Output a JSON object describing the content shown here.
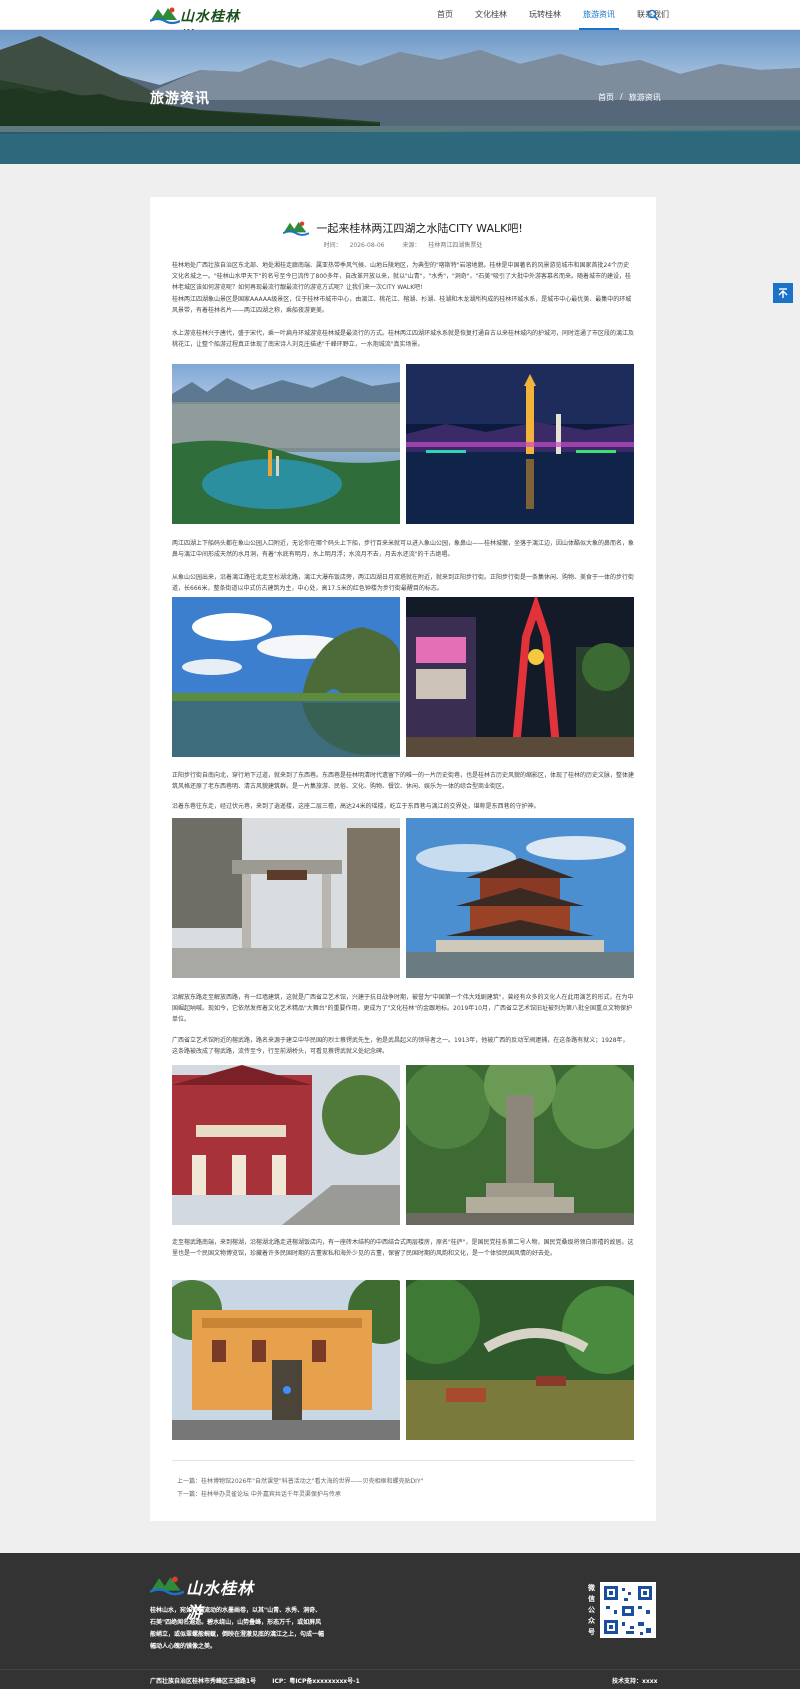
{
  "header": {
    "logo_text": "山水桂林游",
    "nav": [
      "首页",
      "文化桂林",
      "玩转桂林",
      "旅游资讯",
      "联系我们"
    ],
    "active_nav": "旅游资讯"
  },
  "banner": {
    "title": "旅游资讯",
    "breadcrumb": [
      "首页",
      "/",
      "旅游资讯"
    ]
  },
  "article": {
    "title": "一起来桂林两江四湖之水陆CITY WALK吧!",
    "time_label": "时间：",
    "time": "2026-08-06",
    "source_label": "来源：",
    "source": "桂林两江四湖售票处",
    "paragraphs": [
      "桂林地处广西壮族自治区东北部、地处湘桂走廊南端、属亚热带季风气候、山地丘陵地区，为典型的\"喀斯特\"岩溶地貌。桂林是中国著名的风景游览城市和国家首批24个历史文化名城之一。\"桂林山水甲天下\"的名号至今已流传了800多年，自改革开放以来，就以\"山青\"，\"水秀\"，\"洞奇\"，\"石美\"吸引了大批中外游客慕名而来。随着城市的建设，桂林老城区该如何游览呢？如何再现最流行靓最流行的游览方式呢？让我们来一次CITY WALK吧!",
      "桂林两江四湖象山景区是国家AAAAA级景区，位于桂林市城市中心，由漓江、桃花江、榕湖、杉湖、桂湖和木龙湖所构成的桂林环城水系，是城市中心最优美、最集中的环城风景带，有着桂林名片——两江四湖之称，乘船夜游更美。",
      "水上游览桂林兴于唐代，盛于宋代，乘一叶扁舟环城游览桂林城是最流行的方式。桂林两江四湖环城水系就是恢复打通自古以来桂林城内的护城河，同时连通了市区段的漓江及桃花江，让整个船游过程真正体现了南宋诗人刘克庄描述\"千峰环野立，一水抱城流\"真实场景。",
      "两江四湖上下船码头都在象山公园入口附近，无论你在哪个码头上下船，步行百来米就可以进入象山公园，象鼻山——桂林城徽，坐落于漓江边，因山体酷似大象的鼻而名，象鼻与漓江中间形成天然的水月洞，有着\"水底有明月，水上明月浮；水流月不去，月去水还流\"的千古绝唱。",
      "从象山公园出来，沿着漓江路往北走至杉湖北路，漓江大瀑布饭店旁，两江四湖日月双塔就在附近，就来到正阳步行街。正阳步行街是一条集休闲、购物、美食于一体的步行街道，长666米，整条街道以中式仿古建筑为主，中心处，高17.5米的红色钟楼为步行街最醒目的标志。",
      "正阳步行街自南向北，穿行地下过道，就来到了东西巷。东西巷是桂林明清时代遗留下的唯一的一片历史街巷，也是桂林古历史风貌的缩影区，体现了桂林的历史文脉，整体建筑风格还原了老东西巷明、清古风貌建筑群。是一片集旅游、民俗、文化、购物、餐饮、休闲、娱乐为一体的综合型商业街区。",
      "沿着东巷往东走，经过伏元巷，来到了逍遥楼，这座二层三檐，高达24米的瑶楼，屹立于东西巷与漓江的交界处，堪称是东西巷的守护神。",
      "沿解放东路走至解放西路，有一红墙建筑，这就是广西省立艺术馆，兴建于抗日战争时期，被誉为\"中国第一个伟大戏剧建筑\"，曾经有众多的文化人在此用演艺的形式，在为中国崛起呐喊。现如今，它依然发挥着文化艺术精品\"大舞台\"的重要作用，更成为了\"文化桂林\"的金跟地标。2019年10月，广西省立艺术馆旧址被列为第八批全国重点文物保护单位。",
      "广西省立艺术馆附近的榕武路，路名来源于建立中华民国的烈士蔡锷武先生，他是武昌起义的领导者之一。1913年，他被广西的反动军阀逮捕，在这条路有就义；1928年，这条路被改成了榕武路，流传至今，行至前湖桥头，可看见蔡锷武就义处纪念碑。",
      "走至榕武路南端，来到榕湖，沿榕湖北路走进榕湖饭店内，有一座砖木结构的中西结合式两层楼房，原名\"桂庐\"，是国民党桂系第二号人物，国民党桑级将领白崇禧的故居。这里也是一个民国文物博览馆，珍藏着许多民国时期的古董家私和海外少见的古董，保留了民国时期的风韵和文化，是一个体验民国风情的好去处。"
    ],
    "prev_label": "上一篇：",
    "prev_title": "桂林博物馆2026年\"自然课堂\"科普活动之\"看大海的世界——贝壳相框和螺壳贴DIY\"",
    "next_label": "下一篇：",
    "next_title": "桂林举办灵雀论坛 中外嘉宾共话千年灵渠保护与传承"
  },
  "footer": {
    "logo_text": "山水桂林游",
    "description": "桂林山水，宛如一幅流动的水墨画卷，以其\"山青、水秀、洞奇、石美\"四绝闻名遐迩。碧水绕山，山势叠峰，形态万千，或如屏风般峭立，或似翠螺般蜿蜒，倒映在澄澈见底的漓江之上，勾成一幅幅动人心魄的镜像之美。",
    "wechat_label": "微信公众号",
    "address": "广西壮族自治区桂林市秀峰区王城路1号",
    "icp": "ICP：粤ICP备xxxxxxxxx号-1",
    "tech_support": "技术支持：xxxx"
  },
  "colors": {
    "accent": "#1a73c8",
    "footer_bg": "#333333",
    "page_bg": "#efefef"
  }
}
